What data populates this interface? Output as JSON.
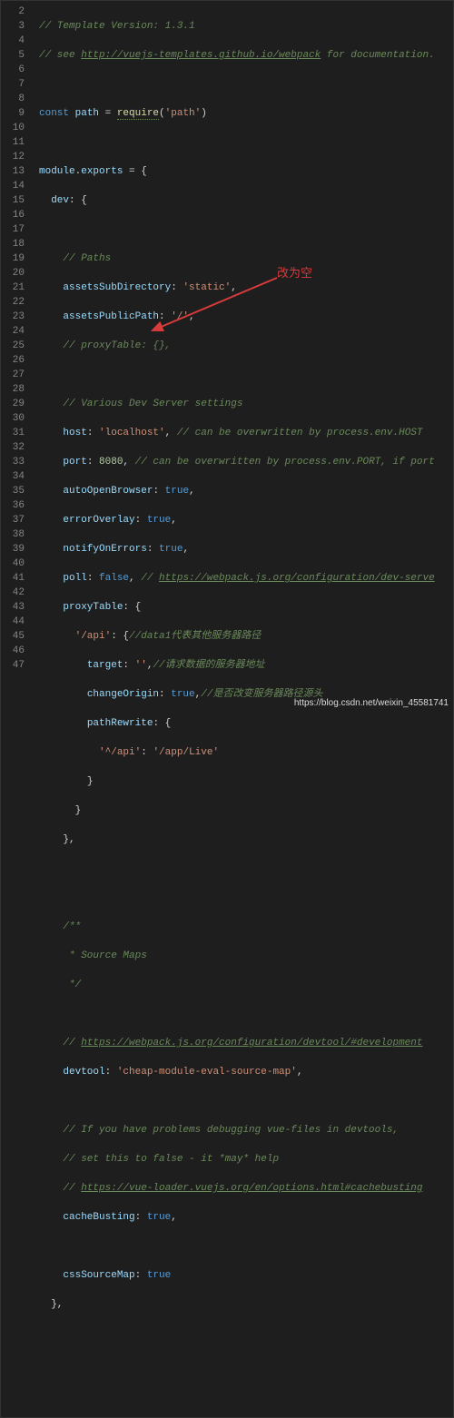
{
  "gutter": {
    "start": 2,
    "end": 47
  },
  "annotation": {
    "label": "改为空"
  },
  "watermark": "https://blog.csdn.net/weixin_45581741",
  "code": {
    "l2": "// Template Version: 1.3.1",
    "l3_a": "// see ",
    "l3_link": "http://vuejs-templates.github.io/webpack",
    "l3_b": " for documentation.",
    "l5_const": "const",
    "l5_path": " path ",
    "l5_eq": "= ",
    "l5_req": "require",
    "l5_arg": "'path'",
    "l7_mod": "module",
    "l7_exp": "exports",
    "l8_dev": "dev",
    "l10": "// Paths",
    "l11_k": "assetsSubDirectory",
    "l11_v": "'static'",
    "l12_k": "assetsPublicPath",
    "l12_v": "'/'",
    "l13": "// proxyTable: {},",
    "l15": "// Various Dev Server settings",
    "l16_k": "host",
    "l16_v": "'localhost'",
    "l16_c": " // can be overwritten by process.env.HOST",
    "l17_k": "port",
    "l17_v": "8080",
    "l17_c": " // can be overwritten by process.env.PORT, if port",
    "l18_k": "autoOpenBrowser",
    "l18_v": "true",
    "l19_k": "errorOverlay",
    "l19_v": "true",
    "l20_k": "notifyOnErrors",
    "l20_v": "true",
    "l21_k": "poll",
    "l21_v": "false",
    "l21_c_a": " // ",
    "l21_link": "https://webpack.js.org/configuration/dev-serve",
    "l22_k": "proxyTable",
    "l23_k": "'/api'",
    "l23_c": "//data1代表其他服务器路径",
    "l24_k": "target",
    "l24_v": "''",
    "l24_c": "//请求数据的服务器地址",
    "l25_k": "changeOrigin",
    "l25_v": "true",
    "l25_c": "//是否改变服务器路径源头",
    "l26_k": "pathRewrite",
    "l27_k": "'^/api'",
    "l27_v": "'/app/Live'",
    "l33": "/**",
    "l34": " * Source Maps",
    "l35": " */",
    "l37_a": "// ",
    "l37_link": "https://webpack.js.org/configuration/devtool/#development",
    "l38_k": "devtool",
    "l38_v": "'cheap-module-eval-source-map'",
    "l40": "// If you have problems debugging vue-files in devtools,",
    "l41": "// set this to false - it *may* help",
    "l42_a": "// ",
    "l42_link": "https://vue-loader.vuejs.org/en/options.html#cachebusting",
    "l43_k": "cacheBusting",
    "l43_v": "true",
    "l45_k": "cssSourceMap",
    "l45_v": "true"
  }
}
